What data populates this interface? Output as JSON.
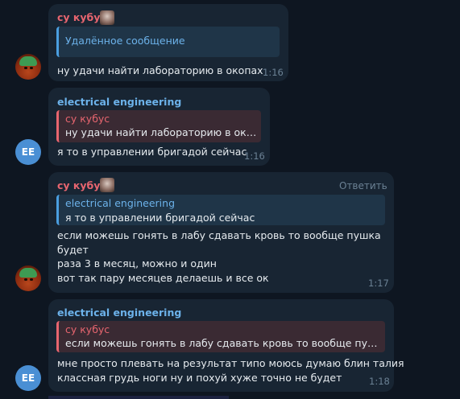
{
  "messages": [
    {
      "author": "су кубус",
      "reply_deleted": "Удалённое сообщение",
      "lines": [
        "ну удачи найти лабораторию в окопах"
      ],
      "time": "1:16"
    },
    {
      "author": "electrical engineering",
      "avatar_initials": "EE",
      "reply": {
        "author": "су кубус",
        "text": "ну удачи найти лабораторию в окопах"
      },
      "lines": [
        "я то в управлении бригадой сейчас"
      ],
      "time": "1:16"
    },
    {
      "author": "су кубус",
      "reply_action": "Ответить",
      "reply": {
        "author": "electrical engineering",
        "text": "я то в управлении бригадой сейчас"
      },
      "lines": [
        "если можешь гонять в лабу сдавать кровь то вообще пушка",
        "будет",
        "раза 3 в месяц, можно и один",
        "вот так пару месяцев делаешь и все ок"
      ],
      "time": "1:17"
    },
    {
      "author": "electrical engineering",
      "avatar_initials": "EE",
      "reply": {
        "author": "су кубус",
        "text": "если можешь гонять в лабу сдавать кровь то вообще пушка будет"
      },
      "lines": [
        "мне просто плевать на результат типо моюсь думаю блин талия",
        "классная грудь ноги ну и похуй хуже точно не будет"
      ],
      "time": "1:18"
    }
  ],
  "colors": {
    "background": "#0e1621",
    "bubble": "#182533",
    "name_red": "#e7656f",
    "name_blue": "#6cb2ea",
    "avatar_ee": "#4a8fd4"
  }
}
